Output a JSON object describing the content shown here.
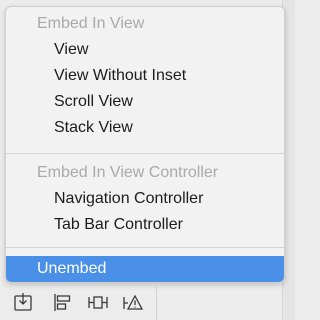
{
  "menu": {
    "sections": [
      {
        "header": "Embed In View",
        "items": [
          "View",
          "View Without Inset",
          "Scroll View",
          "Stack View"
        ]
      },
      {
        "header": "Embed In View Controller",
        "items": [
          "Navigation Controller",
          "Tab Bar Controller"
        ]
      }
    ],
    "selected_item": "Unembed"
  },
  "toolbar": {
    "icons": [
      "embed-in-icon",
      "align-icon",
      "add-constraints-icon",
      "resolve-issues-icon"
    ]
  },
  "colors": {
    "highlight": "#4a90e8",
    "header_text": "#a9a9a9",
    "menu_background": "#f2f2f2"
  }
}
